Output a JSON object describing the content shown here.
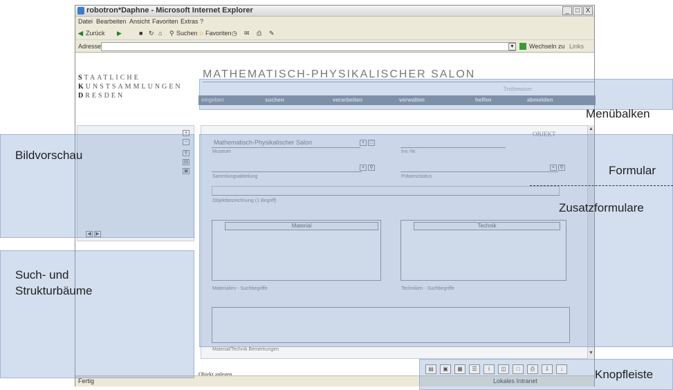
{
  "window": {
    "title": "robotron*Daphne - Microsoft Internet Explorer",
    "controls": [
      "_",
      "□",
      "X"
    ]
  },
  "menubar": {
    "items": [
      "Datei",
      "Bearbeiten",
      "Ansicht",
      "Favoriten",
      "Extras",
      "?"
    ]
  },
  "toolbar": {
    "back": "Zurück",
    "search": "Suchen",
    "favorites": "Favoriten"
  },
  "addressbar": {
    "label": "Adresse",
    "go": "Wechseln zu",
    "links": "Links"
  },
  "logo": {
    "line1_initial": "S",
    "line1_rest": "TAATLICHE",
    "line2_initial": "K",
    "line2_rest": "UNSTSAMMLUNGEN",
    "line3_initial": "D",
    "line3_rest": "RESDEN"
  },
  "page_title": "MATHEMATISCH-PHYSIKALISCHER SALON",
  "user_name": "Testbenutzer",
  "nav": [
    "eingeben",
    "suchen",
    "verarbeiten",
    "verwalten",
    "helfen",
    "abmelden"
  ],
  "form": {
    "heading": "OBJEKT",
    "museum_value": "Mathematisch-Physikalischer Salon",
    "museum_label": "Museum",
    "inv_label": "Inv.-Nr.",
    "sammlung_label": "Sammlungsabteilung",
    "praesenz_label": "Präsenzstatus",
    "objekt_label": "Objektbezeichnung (1 Begriff)",
    "material_header": "Material",
    "technik_header": "Technik",
    "material_search_label": "Materialien - Suchbegriffe",
    "technik_search_label": "Techniken - Suchbegriffe",
    "notes_label": "Material/Technik Bemerkungen"
  },
  "bottom": {
    "action": "Objekt anlegen"
  },
  "status": {
    "left": "Fertig",
    "right": "Lokales Intranet"
  },
  "annotations": {
    "menubalken": "Menübalken",
    "bildvorschau": "Bildvorschau",
    "formular": "Formular",
    "zusatzformulare": "Zusatzformulare",
    "suchbaeume_line1": "Such- und",
    "suchbaeume_line2": "Strukturbäume",
    "knopfleiste": "Knopfleiste"
  },
  "colors": {
    "overlay": "#80a0cd",
    "nav_bar": "#7d8793",
    "window_chrome": "#ece9d8"
  },
  "icons": [
    "ie-icon",
    "back-arrow-icon",
    "search-icon",
    "favorites-star-icon",
    "go-arrow-icon",
    "scroll-up-icon",
    "scroll-down-icon",
    "clear-icon",
    "lookup-icon",
    "zoom-in-icon",
    "zoom-out-icon",
    "magnifier-icon"
  ]
}
